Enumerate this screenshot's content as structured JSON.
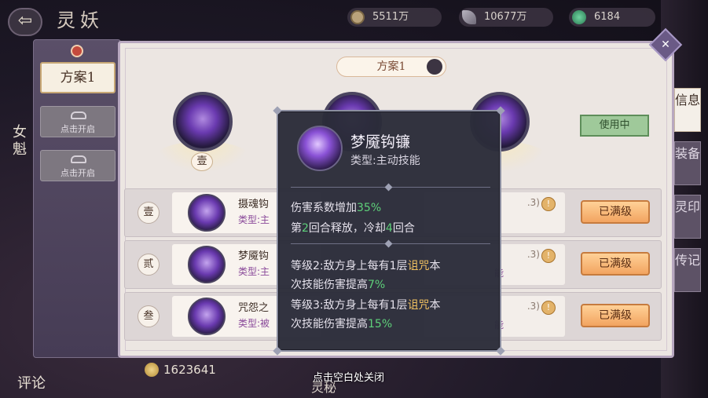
{
  "header": {
    "title": "灵妖",
    "back_icon": "back-arrow-icon",
    "resources": [
      {
        "icon": "coin-icon",
        "value": "5511万"
      },
      {
        "icon": "feather-icon",
        "value": "10677万"
      },
      {
        "icon": "jade-icon",
        "value": "6184"
      }
    ]
  },
  "background": {
    "left_char_label": "女魁"
  },
  "sidebar": {
    "active_scheme": "方案1",
    "locked_slots": [
      {
        "label": "点击开启"
      },
      {
        "label": "点击开启"
      }
    ]
  },
  "panel": {
    "scheme_name": "方案1",
    "in_use_label": "使用中",
    "slot_numbers": [
      "壹",
      "贰",
      "叁"
    ],
    "skills": [
      {
        "num": "壹",
        "name": "摄魂钩",
        "type": "类型:主",
        "right_hint": ".3)",
        "right_sub": "",
        "button": "已满级"
      },
      {
        "num": "贰",
        "name": "梦魇钩",
        "type": "类型:主",
        "right_hint": ".3)",
        "right_sub": "能",
        "button": "已满级"
      },
      {
        "num": "叁",
        "name": "咒怨之",
        "type": "类型:被",
        "right_hint": ".3)",
        "right_sub": "能",
        "button": "已满级"
      }
    ]
  },
  "right_tabs": [
    "信息",
    "装备",
    "灵印",
    "传记"
  ],
  "bottom": {
    "coin_amount": "1623641",
    "left_label": "评论",
    "mid_label": "灵秘",
    "close_hint": "点击空白处关闭"
  },
  "tooltip": {
    "skill_name": "梦魇钩镰",
    "skill_type": "类型:主动技能",
    "line1_pre": "伤害系数增加",
    "line1_val": "35%",
    "line2_pre": "第",
    "line2_num": "2",
    "line2_mid": "回合释放，冷却",
    "line2_cd": "4",
    "line2_post": "回合",
    "lv2_line1_pre": "等级2:敌方身上每有1层",
    "lv2_curse": "诅咒",
    "lv2_line1_post": "本",
    "lv2_line2_pre": "次技能伤害提高",
    "lv2_val": "7%",
    "lv3_line1_pre": "等级3:敌方身上每有1层",
    "lv3_curse": "诅咒",
    "lv3_line1_post": "本",
    "lv3_line2_pre": "次技能伤害提高",
    "lv3_val": "15%"
  },
  "colors": {
    "highlight_green": "#5ed07a",
    "highlight_gold": "#f0c060",
    "max_button": "#f2a460",
    "in_use": "#9fc99a"
  }
}
